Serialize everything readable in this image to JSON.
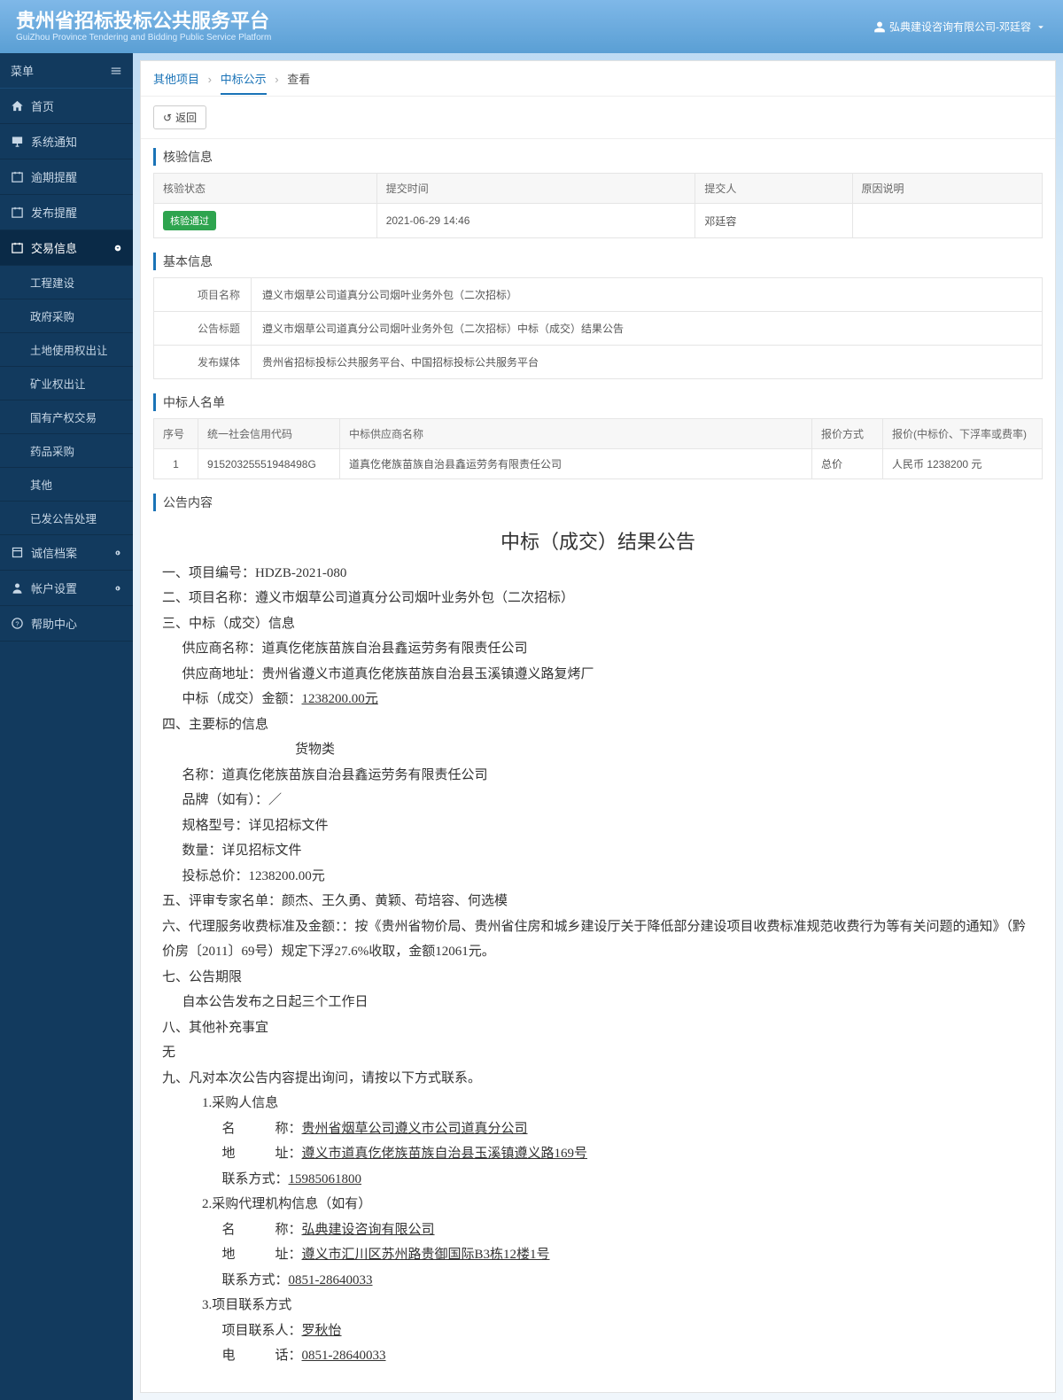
{
  "header": {
    "title": "贵州省招标投标公共服务平台",
    "subtitle": "GuiZhou Province Tendering and Bidding Public Service Platform",
    "user": "弘典建设咨询有限公司-邓廷容"
  },
  "sidebar": {
    "menu_label": "菜单",
    "items": {
      "home": "首页",
      "sys_notice": "系统通知",
      "overdue": "逾期提醒",
      "publish": "发布提醒",
      "trade": "交易信息",
      "credit": "诚信档案",
      "account": "帐户设置",
      "help": "帮助中心"
    },
    "trade_sub": {
      "eng": "工程建设",
      "gov": "政府采购",
      "land": "土地使用权出让",
      "mine": "矿业权出让",
      "state": "国有产权交易",
      "drug": "药品采购",
      "other": "其他",
      "processed": "已发公告处理"
    }
  },
  "breadcrumb": {
    "a": "其他项目",
    "b": "中标公示",
    "c": "查看"
  },
  "back_btn": "返回",
  "verify": {
    "title": "核验信息",
    "cols": {
      "status": "核验状态",
      "time": "提交时间",
      "by": "提交人",
      "reason": "原因说明"
    },
    "row": {
      "status": "核验通过",
      "time": "2021-06-29 14:46",
      "by": "邓廷容",
      "reason": ""
    }
  },
  "basic": {
    "title": "基本信息",
    "rows": {
      "proj_name_k": "项目名称",
      "proj_name_v": "遵义市烟草公司道真分公司烟叶业务外包（二次招标）",
      "notice_title_k": "公告标题",
      "notice_title_v": "遵义市烟草公司道真分公司烟叶业务外包（二次招标）中标（成交）结果公告",
      "media_k": "发布媒体",
      "media_v": "贵州省招标投标公共服务平台、中国招标投标公共服务平台"
    }
  },
  "winners": {
    "title": "中标人名单",
    "cols": {
      "seq": "序号",
      "code": "统一社会信用代码",
      "name": "中标供应商名称",
      "mode": "报价方式",
      "price": "报价(中标价、下浮率或费率)"
    },
    "row": {
      "seq": "1",
      "code": "91520325551948498G",
      "name": "道真仡佬族苗族自治县鑫运劳务有限责任公司",
      "mode": "总价",
      "price": "人民币 1238200 元"
    }
  },
  "notice": {
    "panel_title": "公告内容",
    "title": "中标（成交）结果公告",
    "l1": "一、项目编号：HDZB-2021-080",
    "l2": "二、项目名称：遵义市烟草公司道真分公司烟叶业务外包（二次招标）",
    "l3": "三、中标（成交）信息",
    "l3a": "供应商名称：道真仡佬族苗族自治县鑫运劳务有限责任公司",
    "l3b": "供应商地址：贵州省遵义市道真仡佬族苗族自治县玉溪镇遵义路复烤厂",
    "l3c_pre": "中标（成交）金额：",
    "l3c_val": "1238200.00元",
    "l4": "四、主要标的信息",
    "l4_cat": "货物类",
    "l4a": "名称：道真仡佬族苗族自治县鑫运劳务有限责任公司",
    "l4b": "品牌（如有）：／",
    "l4c": "规格型号：详见招标文件",
    "l4d": "数量：详见招标文件",
    "l4e": "投标总价：1238200.00元",
    "l5": "五、评审专家名单：颜杰、王久勇、黄颖、苟培容、何选模",
    "l6": "六、代理服务收费标准及金额：：按《贵州省物价局、贵州省住房和城乡建设厅关于降低部分建设项目收费标准规范收费行为等有关问题的通知》（黔价房〔2011〕69号）规定下浮27.6%收取，金额12061元。",
    "l7": "七、公告期限",
    "l7a": "自本公告发布之日起三个工作日",
    "l8": "八、其他补充事宜",
    "l8a": "无",
    "l9": "九、凡对本次公告内容提出询问，请按以下方式联系。",
    "l9_1": "1.采购人信息",
    "l9_1a_pre": "名　　　称：",
    "l9_1a_val": "贵州省烟草公司遵义市公司道真分公司",
    "l9_1b_pre": "地　　　址：",
    "l9_1b_val": "遵义市道真仡佬族苗族自治县玉溪镇遵义路169号",
    "l9_1c_pre": "联系方式：",
    "l9_1c_val": "15985061800",
    "l9_2": "2.采购代理机构信息（如有）",
    "l9_2a_pre": "名　　　称：",
    "l9_2a_val": "弘典建设咨询有限公司",
    "l9_2b_pre": "地　　　址：",
    "l9_2b_val": "遵义市汇川区苏州路贵御国际B3栋12楼1号",
    "l9_2c_pre": "联系方式：",
    "l9_2c_val": "0851-28640033",
    "l9_3": "3.项目联系方式",
    "l9_3a_pre": "项目联系人：",
    "l9_3a_val": "罗秋怡",
    "l9_3b_pre": "电　　　话：",
    "l9_3b_val": "0851-28640033"
  }
}
